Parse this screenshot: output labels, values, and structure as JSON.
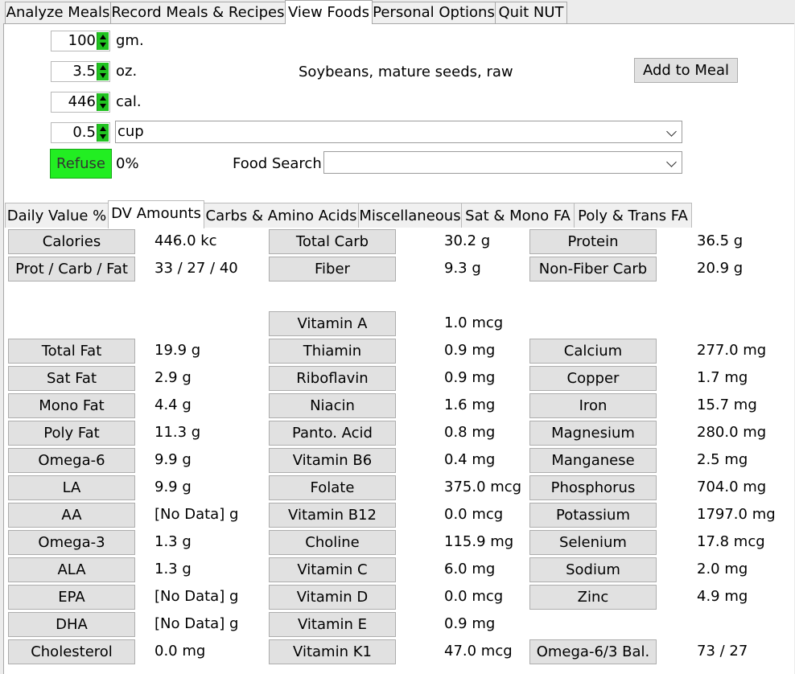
{
  "main_tabs": [
    "Analyze Meals",
    "Record Meals & Recipes",
    "View Foods",
    "Personal Options",
    "Quit NUT"
  ],
  "active_main_tab": "View Foods",
  "quantity": {
    "grams": "100",
    "grams_unit": "gm.",
    "ounces": "3.5",
    "ounces_unit": "oz.",
    "calories": "446",
    "calories_unit": "cal.",
    "servings": "0.5",
    "serving_unit": "cup"
  },
  "food_name": "Soybeans, mature seeds, raw",
  "add_to_meal": "Add to Meal",
  "refuse_label": "Refuse",
  "refuse_value": "0%",
  "food_search_label": "Food Search",
  "food_search_value": "",
  "sub_tabs": [
    "Daily Value %",
    "DV Amounts",
    "Carbs & Amino Acids",
    "Miscellaneous",
    "Sat & Mono FA",
    "Poly & Trans FA"
  ],
  "active_sub_tab": "DV Amounts",
  "nutrients": {
    "col1": [
      {
        "label": "Calories",
        "value": "446.0 kc"
      },
      {
        "label": "Prot / Carb / Fat",
        "value": "33 / 27 / 40"
      },
      null,
      null,
      {
        "label": "Total Fat",
        "value": "19.9 g"
      },
      {
        "label": "Sat Fat",
        "value": "2.9 g"
      },
      {
        "label": "Mono Fat",
        "value": "4.4 g"
      },
      {
        "label": "Poly Fat",
        "value": "11.3 g"
      },
      {
        "label": "Omega-6",
        "value": "9.9 g"
      },
      {
        "label": "LA",
        "value": "9.9 g"
      },
      {
        "label": "AA",
        "value": "[No Data] g"
      },
      {
        "label": "Omega-3",
        "value": "1.3 g"
      },
      {
        "label": "ALA",
        "value": "1.3 g"
      },
      {
        "label": "EPA",
        "value": "[No Data] g"
      },
      {
        "label": "DHA",
        "value": "[No Data] g"
      },
      {
        "label": "Cholesterol",
        "value": "0.0 mg"
      }
    ],
    "col2": [
      {
        "label": "Total Carb",
        "value": "30.2 g"
      },
      {
        "label": "Fiber",
        "value": "9.3 g"
      },
      null,
      {
        "label": "Vitamin A",
        "value": "1.0 mcg"
      },
      {
        "label": "Thiamin",
        "value": "0.9 mg"
      },
      {
        "label": "Riboflavin",
        "value": "0.9 mg"
      },
      {
        "label": "Niacin",
        "value": "1.6 mg"
      },
      {
        "label": "Panto. Acid",
        "value": "0.8 mg"
      },
      {
        "label": "Vitamin B6",
        "value": "0.4 mg"
      },
      {
        "label": "Folate",
        "value": "375.0 mcg"
      },
      {
        "label": "Vitamin B12",
        "value": "0.0 mcg"
      },
      {
        "label": "Choline",
        "value": "115.9 mg"
      },
      {
        "label": "Vitamin C",
        "value": "6.0 mg"
      },
      {
        "label": "Vitamin D",
        "value": "0.0 mcg"
      },
      {
        "label": "Vitamin E",
        "value": "0.9 mg"
      },
      {
        "label": "Vitamin K1",
        "value": "47.0 mcg"
      }
    ],
    "col3": [
      {
        "label": "Protein",
        "value": "36.5 g"
      },
      {
        "label": "Non-Fiber Carb",
        "value": "20.9 g"
      },
      null,
      null,
      {
        "label": "Calcium",
        "value": "277.0 mg"
      },
      {
        "label": "Copper",
        "value": "1.7 mg"
      },
      {
        "label": "Iron",
        "value": "15.7 mg"
      },
      {
        "label": "Magnesium",
        "value": "280.0 mg"
      },
      {
        "label": "Manganese",
        "value": "2.5 mg"
      },
      {
        "label": "Phosphorus",
        "value": "704.0 mg"
      },
      {
        "label": "Potassium",
        "value": "1797.0 mg"
      },
      {
        "label": "Selenium",
        "value": "17.8 mcg"
      },
      {
        "label": "Sodium",
        "value": "2.0 mg"
      },
      {
        "label": "Zinc",
        "value": "4.9 mg"
      },
      null,
      {
        "label": "Omega-6/3 Bal.",
        "value": "73 / 27"
      }
    ]
  },
  "colors": {
    "refuse_green": "#22ee22",
    "spinner_green": "#21c321"
  }
}
